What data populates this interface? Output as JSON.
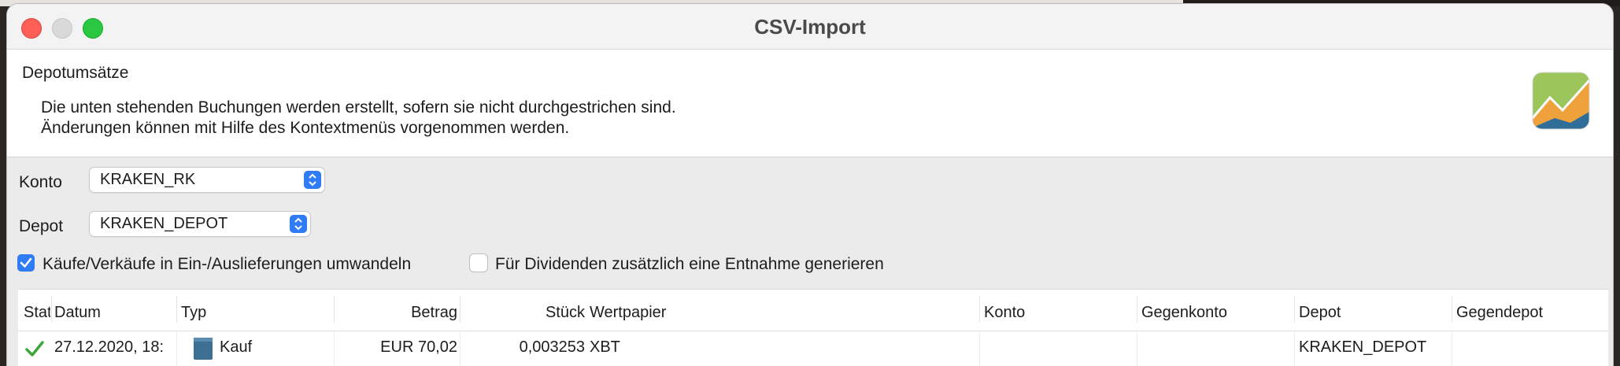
{
  "window": {
    "title": "CSV-Import"
  },
  "header": {
    "heading": "Depotumsätze",
    "line1": "Die unten stehenden Buchungen werden erstellt, sofern sie nicht durchgestrichen sind.",
    "line2": "Änderungen können mit Hilfe des Kontextmenüs vorgenommen werden."
  },
  "form": {
    "konto_label": "Konto",
    "konto_value": "KRAKEN_RK",
    "depot_label": "Depot",
    "depot_value": "KRAKEN_DEPOT",
    "convert_checkbox": {
      "label": "Käufe/Verkäufe in Ein-/Auslieferungen umwandeln",
      "checked": true
    },
    "dividend_checkbox": {
      "label": "Für Dividenden zusätzlich eine Entnahme generieren",
      "checked": false
    }
  },
  "table": {
    "columns": [
      "Status",
      "Datum",
      "Typ",
      "Betrag",
      "Stück",
      "Wertpapier",
      "Konto",
      "Gegenkonto",
      "Depot",
      "Gegendepot"
    ],
    "rows": [
      {
        "status_icon": "checkmark-icon",
        "datum": "27.12.2020, 18:",
        "typ": "Kauf",
        "betrag": "EUR 70,02",
        "stueck": "0,003253",
        "wertpapier": "XBT",
        "konto": "",
        "gegenkonto": "",
        "depot": "KRAKEN_DEPOT",
        "gegendepot": ""
      }
    ]
  },
  "colors": {
    "accent": "#2f7cf6",
    "check": "#3aa63a",
    "close": "#fe5f57",
    "zoom": "#2ac840"
  }
}
